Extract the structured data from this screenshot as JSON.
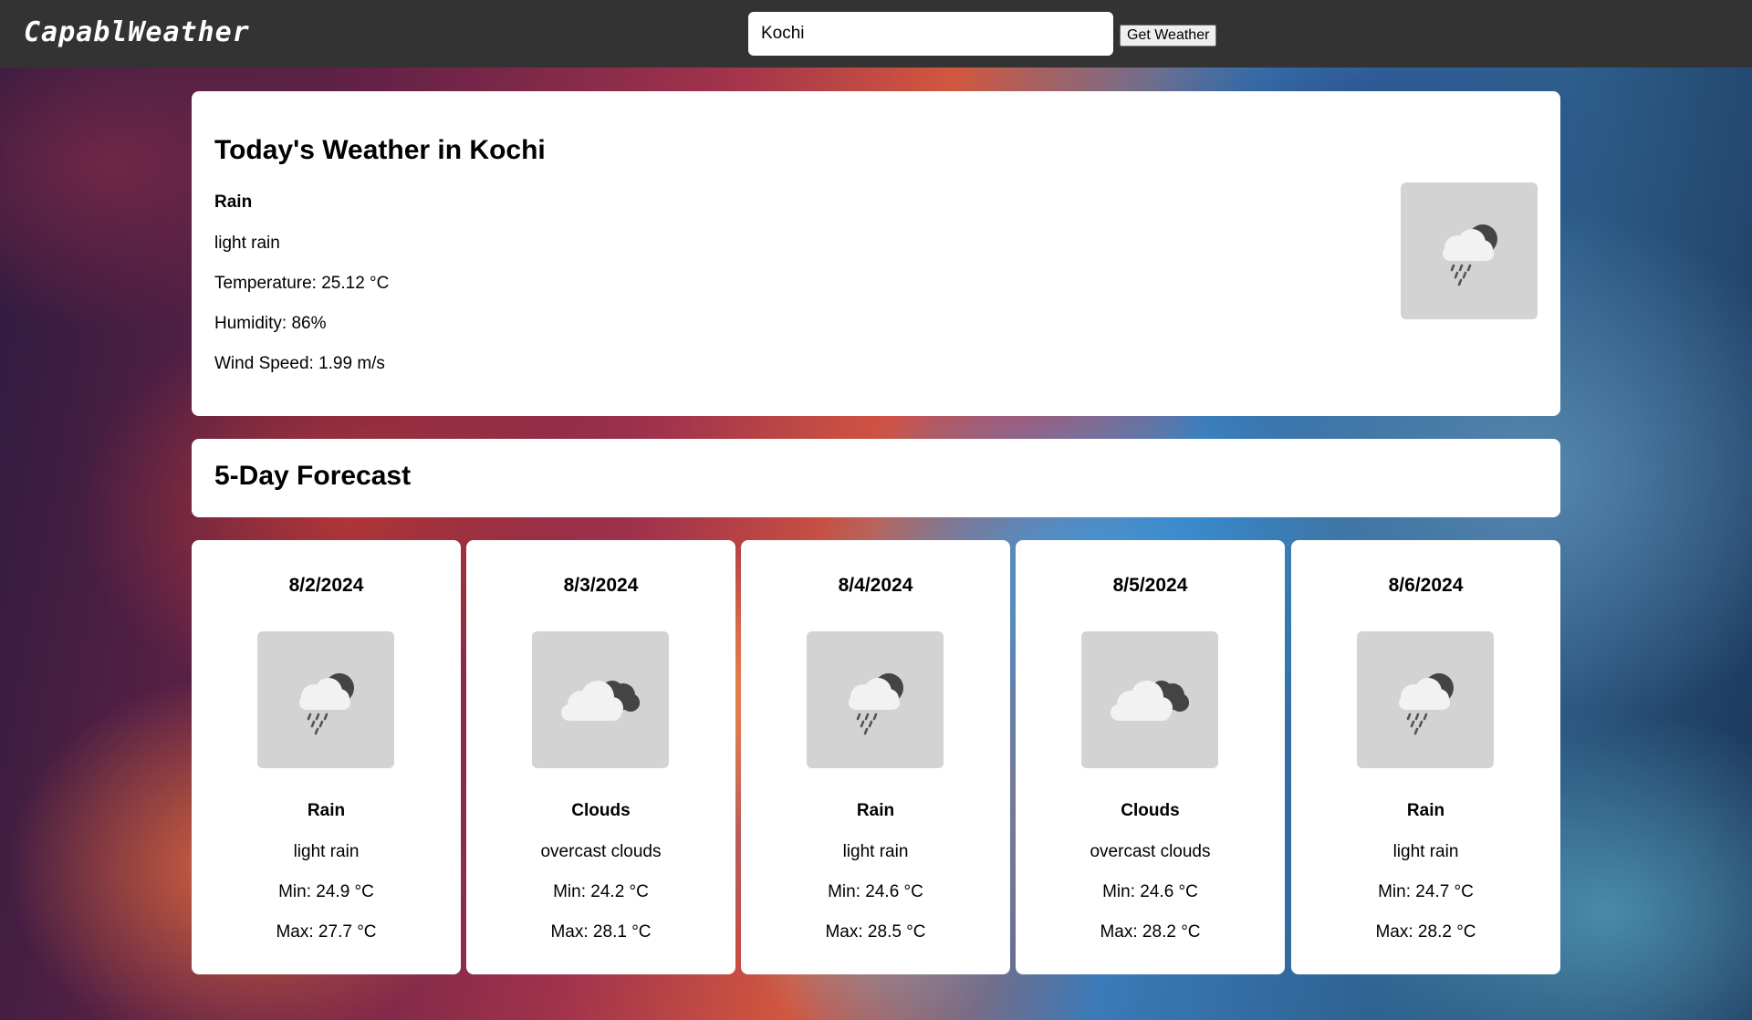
{
  "app": {
    "logo": "CapablWeather"
  },
  "search": {
    "value": "Kochi",
    "button_label": "Get Weather"
  },
  "today": {
    "title": "Today's Weather in Kochi",
    "main": "Rain",
    "description": "light rain",
    "temperature": "Temperature: 25.12 °C",
    "humidity": "Humidity: 86%",
    "wind": "Wind Speed: 1.99 m/s",
    "icon": "rain-icon"
  },
  "forecast": {
    "title": "5-Day Forecast",
    "days": [
      {
        "date": "8/2/2024",
        "main": "Rain",
        "description": "light rain",
        "min": "Min: 24.9 °C",
        "max": "Max: 27.7 °C",
        "icon": "rain-icon"
      },
      {
        "date": "8/3/2024",
        "main": "Clouds",
        "description": "overcast clouds",
        "min": "Min: 24.2 °C",
        "max": "Max: 28.1 °C",
        "icon": "clouds-icon"
      },
      {
        "date": "8/4/2024",
        "main": "Rain",
        "description": "light rain",
        "min": "Min: 24.6 °C",
        "max": "Max: 28.5 °C",
        "icon": "rain-icon"
      },
      {
        "date": "8/5/2024",
        "main": "Clouds",
        "description": "overcast clouds",
        "min": "Min: 24.6 °C",
        "max": "Max: 28.2 °C",
        "icon": "clouds-icon"
      },
      {
        "date": "8/6/2024",
        "main": "Rain",
        "description": "light rain",
        "min": "Min: 24.7 °C",
        "max": "Max: 28.2 °C",
        "icon": "rain-icon"
      }
    ]
  },
  "colors": {
    "navbar": "#333333",
    "card": "#ffffff",
    "icon_box": "#d3d3d3"
  }
}
